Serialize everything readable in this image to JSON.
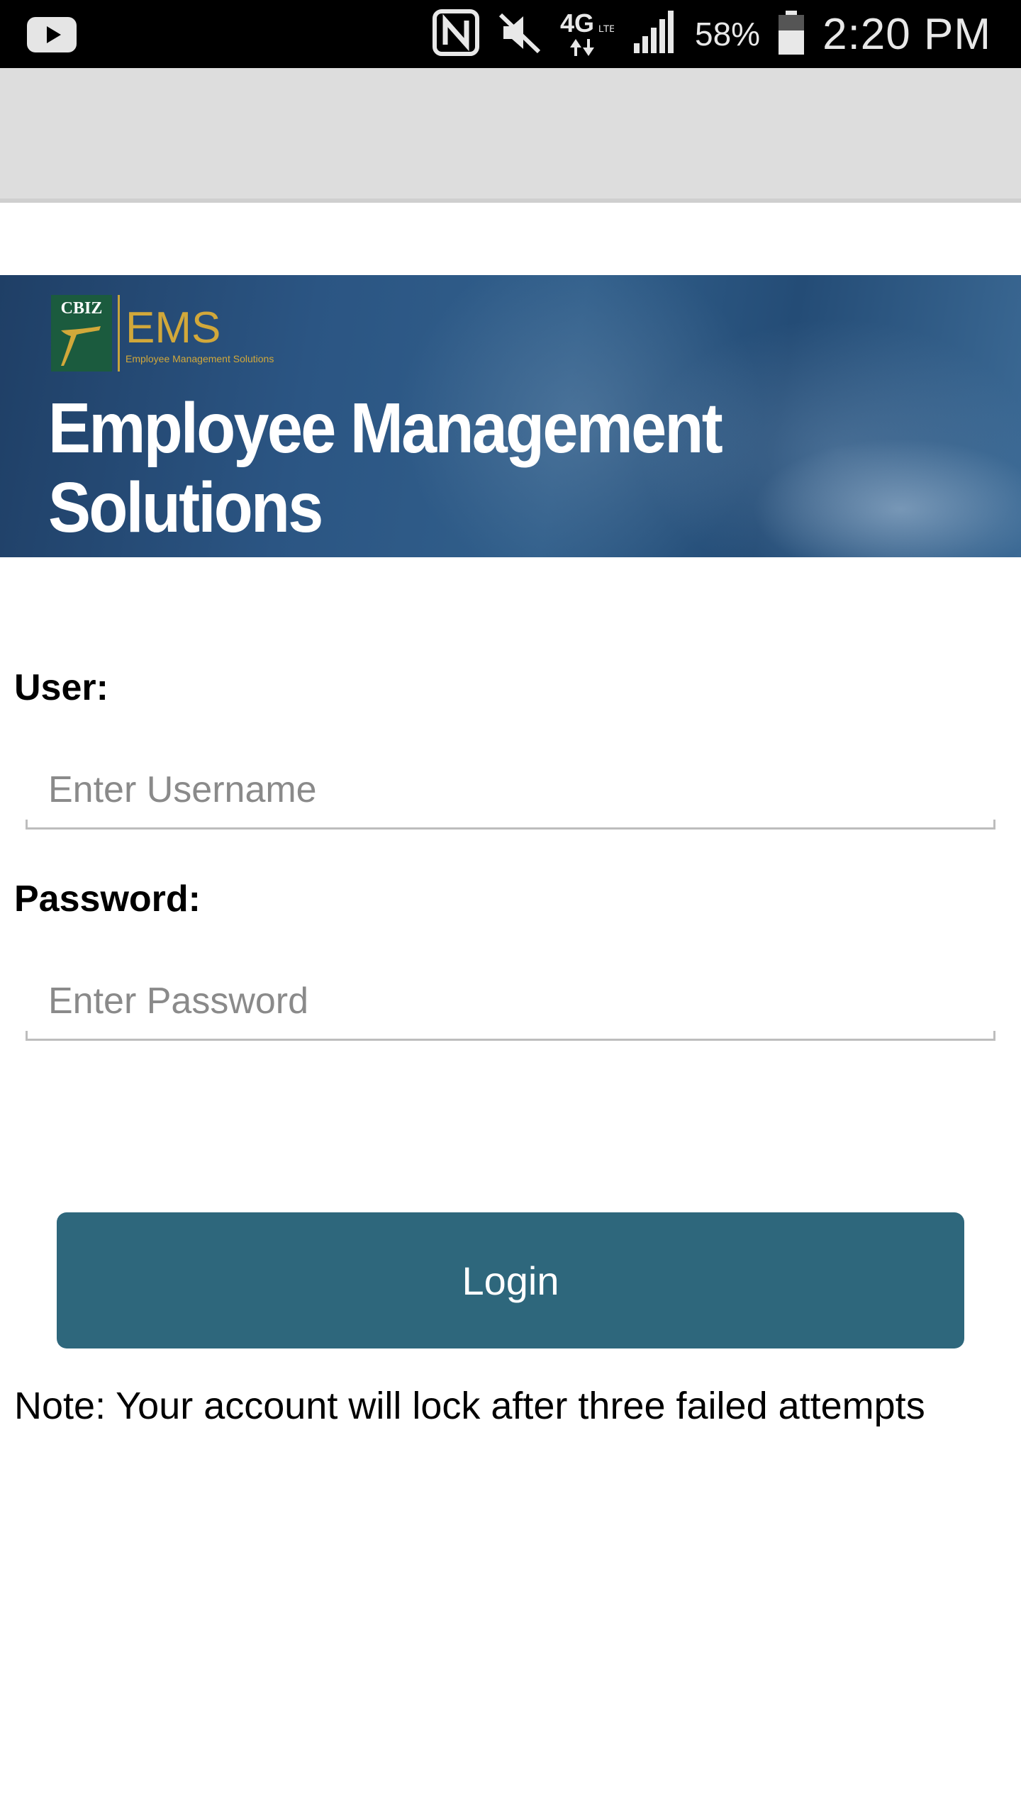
{
  "status_bar": {
    "battery_percent": "58%",
    "time": "2:20 PM",
    "network": "4G LTE",
    "icons": [
      "youtube-icon",
      "nfc-icon",
      "mute-icon",
      "lte-icon",
      "signal-icon",
      "battery-icon"
    ]
  },
  "banner": {
    "logo_cbiz": "CBIZ",
    "logo_ems": "EMS",
    "logo_subtitle": "Employee Management Solutions",
    "title_line1": "Employee Management",
    "title_line2": "Solutions"
  },
  "form": {
    "user_label": "User:",
    "username_placeholder": "Enter Username",
    "username_value": "",
    "password_label": "Password:",
    "password_placeholder": "Enter Password",
    "password_value": "",
    "login_label": "Login",
    "note": "Note: Your account will lock after three failed attempts"
  },
  "colors": {
    "status_bar": "#000000",
    "toolbar": "#dddddd",
    "login_button": "#2e677c",
    "logo_gold": "#d2a83a",
    "logo_green": "#1b5b3e"
  }
}
